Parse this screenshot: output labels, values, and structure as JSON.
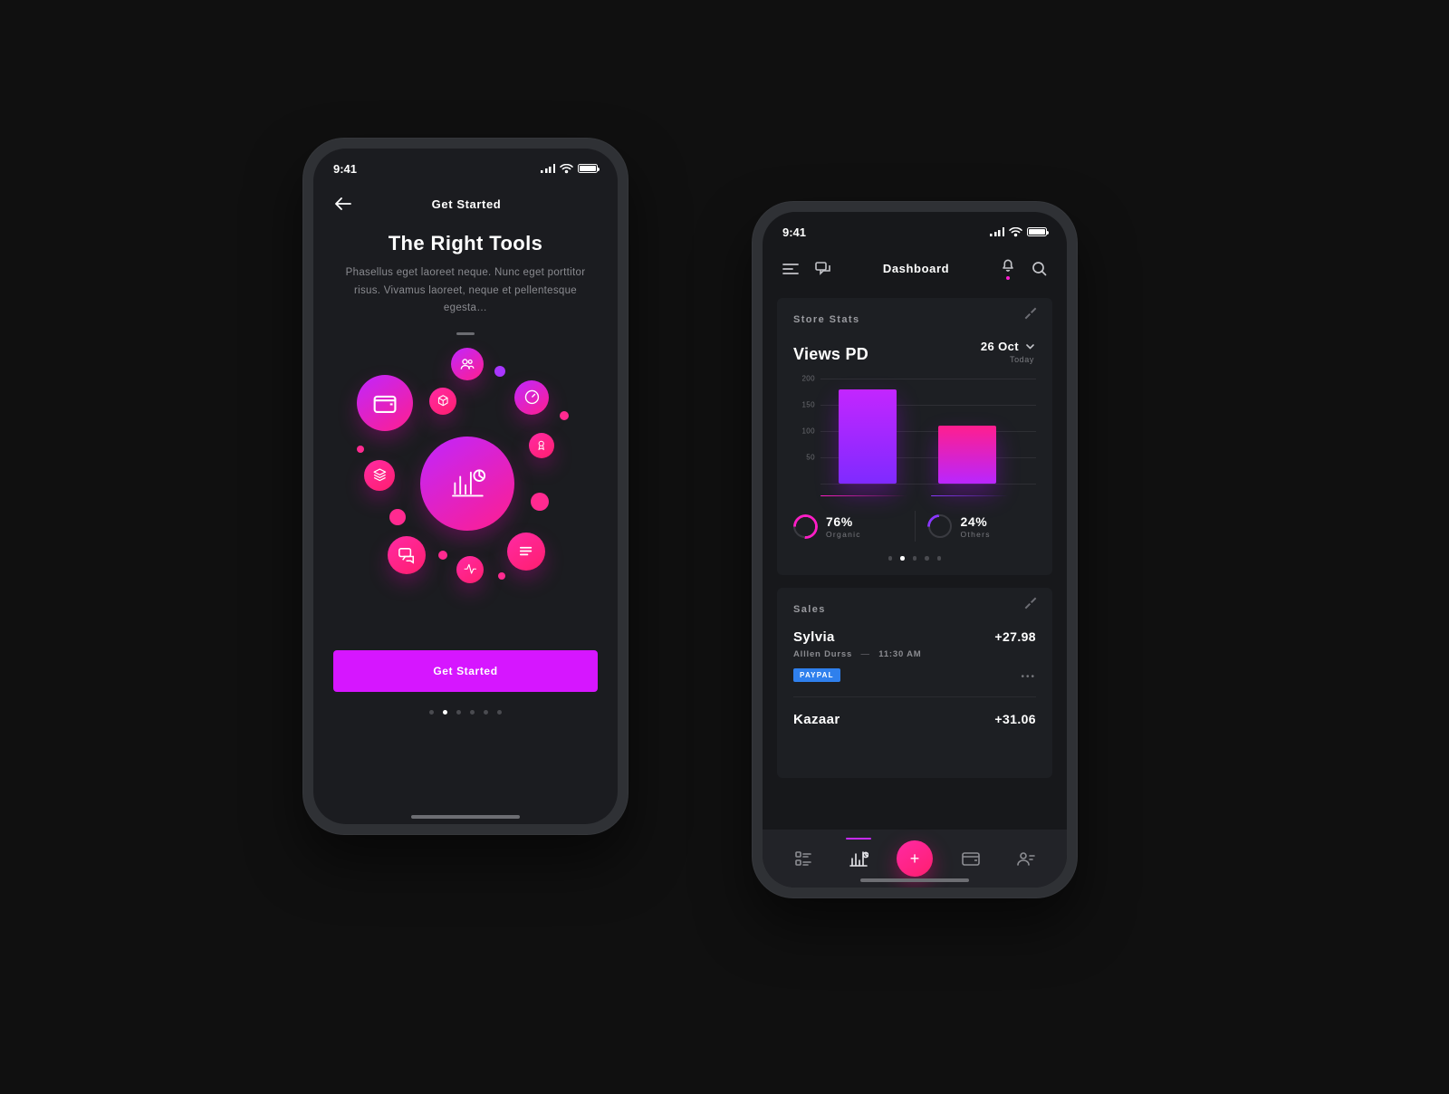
{
  "status": {
    "time": "9:41"
  },
  "onboarding": {
    "header_title": "Get Started",
    "title": "The Right Tools",
    "description": "Phasellus eget laoreet neque. Nunc eget porttitor risus. Vivamus laoreet, neque et pellentesque egesta…",
    "cta": "Get Started",
    "pager": {
      "count": 6,
      "active_index": 1
    }
  },
  "dashboard": {
    "title": "Dashboard",
    "stats_card": {
      "label": "Store Stats",
      "views_title": "Views PD",
      "date": "26 Oct",
      "date_sub": "Today",
      "metrics": [
        {
          "value": "76%",
          "label": "Organic"
        },
        {
          "value": "24%",
          "label": "Others"
        }
      ],
      "pager": {
        "count": 5,
        "active_index": 1
      }
    },
    "sales_card": {
      "label": "Sales",
      "rows": [
        {
          "name": "Sylvia",
          "sub_name": "Alllen Durss",
          "time": "11:30 AM",
          "amount": "+27.98",
          "tag": "PAYPAL"
        },
        {
          "name": "Kazaar",
          "amount": "+31.06"
        }
      ]
    }
  },
  "chart_data": {
    "type": "bar",
    "title": "Views PD",
    "xlabel": "",
    "ylabel": "",
    "ylim": [
      0,
      200
    ],
    "yticks": [
      50,
      100,
      150,
      200
    ],
    "categories": [
      "Organic",
      "Others"
    ],
    "values": [
      180,
      110
    ]
  },
  "colors": {
    "accent_gradient_start": "#c026ff",
    "accent_gradient_end": "#ff1e8e",
    "cta": "#d616ff",
    "paypal": "#2f80ed"
  }
}
